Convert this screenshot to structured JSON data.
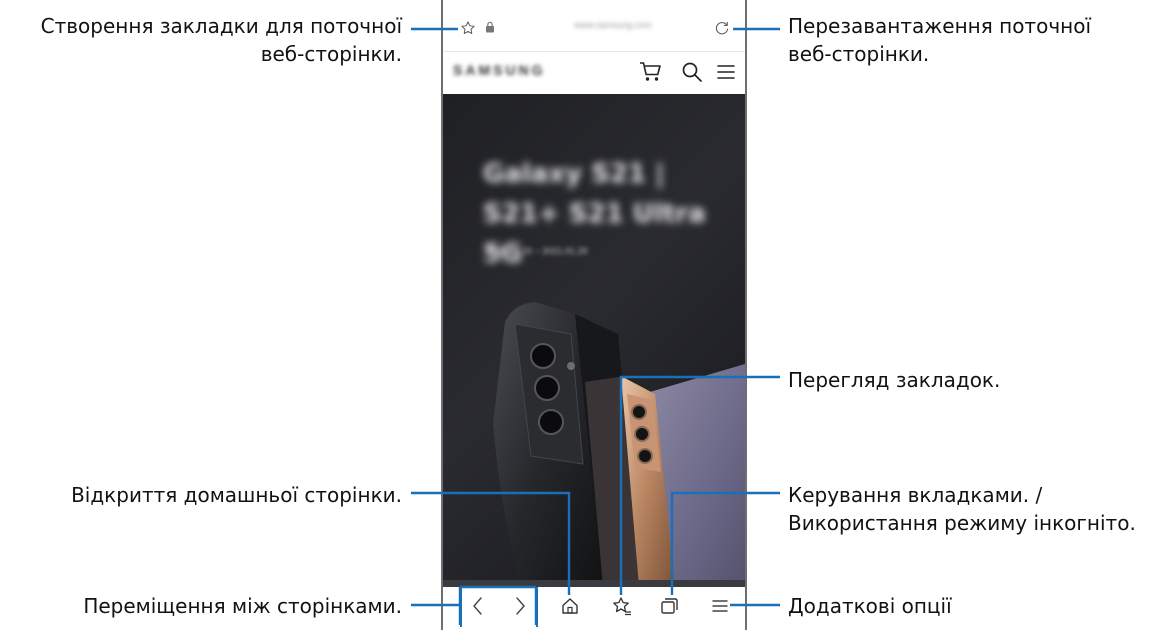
{
  "browser": {
    "url_text": "www.samsung.com",
    "site_logo_text": "SAMSUNG",
    "hero_headline": "Galaxy S21 | S21+ S21 Ultra 5G",
    "hero_dates": "2021.01.15 ~ 2021.01.29"
  },
  "callouts": {
    "bookmark_current": {
      "line1": "Створення закладки для поточної",
      "line2": "веб-сторінки."
    },
    "reload": {
      "line1": "Перезавантаження поточної",
      "line2": "веб-сторінки."
    },
    "view_bookmarks": {
      "line1": "Перегляд закладок."
    },
    "open_home": {
      "line1": "Відкриття домашньої сторінки."
    },
    "tabs_manage": {
      "line1": "Керування вкладками. /",
      "line2": "Використання режиму інкогніто."
    },
    "navigate_pages": {
      "line1": "Переміщення між сторінками."
    },
    "more_options": {
      "line1": "Додаткові опції"
    }
  },
  "colors": {
    "leader_line": "#1a70b8",
    "hero_background": "#1f2024",
    "phone_frame": "#6e6e6e"
  },
  "icons": {
    "url_bar": [
      "star-outline-icon",
      "lock-icon",
      "reload-icon"
    ],
    "site_header": [
      "cart-icon",
      "search-icon",
      "hamburger-menu-icon"
    ],
    "toolbar": [
      "back-chevron-icon",
      "forward-chevron-icon",
      "home-icon",
      "bookmarks-icon",
      "tabs-icon",
      "more-options-icon"
    ]
  }
}
